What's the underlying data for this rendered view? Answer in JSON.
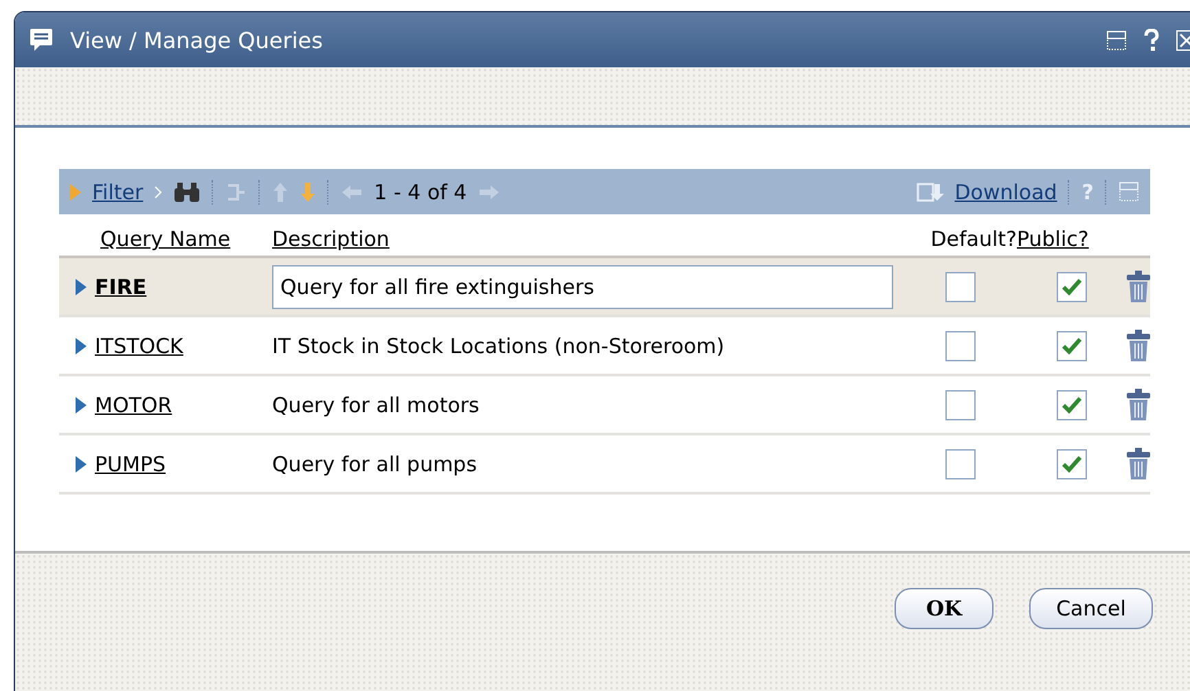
{
  "window": {
    "title": "View / Manage Queries"
  },
  "toolbar": {
    "filter": "Filter",
    "pager": "1 - 4 of 4",
    "download": "Download",
    "help": "?"
  },
  "table": {
    "columns": [
      "Query Name",
      "Description",
      "Default?",
      "Public?"
    ],
    "rows": [
      {
        "name": "FIRE",
        "description": "Query for all fire extinguishers",
        "default": false,
        "public": true,
        "selected": true
      },
      {
        "name": "ITSTOCK",
        "description": "IT Stock in Stock Locations (non-Storeroom)",
        "default": false,
        "public": true,
        "selected": false
      },
      {
        "name": "MOTOR",
        "description": "Query for all motors",
        "default": false,
        "public": true,
        "selected": false
      },
      {
        "name": "PUMPS",
        "description": "Query for all pumps",
        "default": false,
        "public": true,
        "selected": false
      }
    ]
  },
  "buttons": [
    {
      "label": "OK",
      "kind": "primary"
    },
    {
      "label": "Cancel",
      "kind": "secondary"
    }
  ]
}
